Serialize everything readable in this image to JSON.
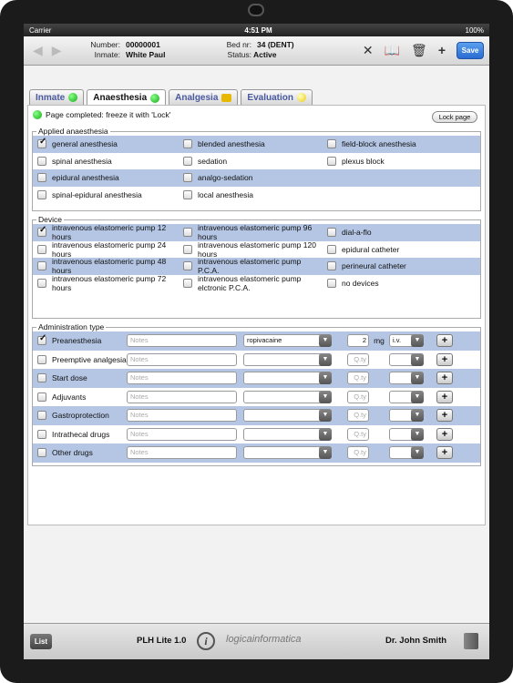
{
  "status": {
    "carrier": "Carrier",
    "time": "4:51 PM",
    "battery": "100%"
  },
  "header": {
    "number_label": "Number:",
    "number_value": "00000001",
    "inmate_label": "Inmate:",
    "inmate_value": "White Paul",
    "bed_label": "Bed nr:",
    "bed_value": "34 (DENT)",
    "status_label": "Status:",
    "status_value": "Active",
    "save_label": "Save"
  },
  "tabs": [
    {
      "label": "Inmate",
      "indicator": "green"
    },
    {
      "label": "Anaesthesia",
      "indicator": "green"
    },
    {
      "label": "Analgesia",
      "indicator": "lock"
    },
    {
      "label": "Evaluation",
      "indicator": "yellow"
    }
  ],
  "notice": "Page completed: freeze it with 'Lock'",
  "lock_button": "Lock page",
  "applied": {
    "legend": "Applied anaesthesia",
    "rows": [
      [
        {
          "label": "general anesthesia",
          "checked": true
        },
        {
          "label": "blended anesthesia",
          "checked": false
        },
        {
          "label": "field-block anesthesia",
          "checked": false
        }
      ],
      [
        {
          "label": "spinal anesthesia",
          "checked": false
        },
        {
          "label": "sedation",
          "checked": false
        },
        {
          "label": "plexus block",
          "checked": false
        }
      ],
      [
        {
          "label": "epidural anesthesia",
          "checked": false
        },
        {
          "label": "analgo-sedation",
          "checked": false
        },
        null
      ],
      [
        {
          "label": "spinal-epidural anesthesia",
          "checked": false
        },
        {
          "label": "local anesthesia",
          "checked": false
        },
        null
      ]
    ]
  },
  "device": {
    "legend": "Device",
    "rows": [
      [
        {
          "label": "intravenous elastomeric pump 12 hours",
          "checked": true
        },
        {
          "label": "intravenous elastomeric pump 96 hours",
          "checked": false
        },
        {
          "label": "dial-a-flo",
          "checked": false
        }
      ],
      [
        {
          "label": "intravenous elastomeric pump 24 hours",
          "checked": false
        },
        {
          "label": "intravenous elastomeric pump 120 hours",
          "checked": false
        },
        {
          "label": "epidural catheter",
          "checked": false
        }
      ],
      [
        {
          "label": "intravenous elastomeric pump 48 hours",
          "checked": false
        },
        {
          "label": "intravenous elastomeric pump P.C.A.",
          "checked": false
        },
        {
          "label": "perineural catheter",
          "checked": false
        }
      ],
      [
        {
          "label": "intravenous elastomeric pump 72 hours",
          "checked": false
        },
        {
          "label": "intravenous elastomeric pump elctronic P.C.A.",
          "checked": false
        },
        {
          "label": "no devices",
          "checked": false
        }
      ]
    ]
  },
  "admin": {
    "legend": "Administration type",
    "notes_placeholder": "Notes",
    "qty_placeholder": "Q.ty",
    "rows": [
      {
        "label": "Preanesthesia",
        "checked": true,
        "drug": "ropivacaine",
        "qty": "2",
        "unit": "mg",
        "route": "i.v."
      },
      {
        "label": "Preemptive analgesia",
        "checked": false,
        "drug": "",
        "qty": "",
        "unit": "",
        "route": ""
      },
      {
        "label": "Start dose",
        "checked": false,
        "drug": "",
        "qty": "",
        "unit": "",
        "route": ""
      },
      {
        "label": "Adjuvants",
        "checked": false,
        "drug": "",
        "qty": "",
        "unit": "",
        "route": ""
      },
      {
        "label": "Gastroprotection",
        "checked": false,
        "drug": "",
        "qty": "",
        "unit": "",
        "route": ""
      },
      {
        "label": "Intrathecal drugs",
        "checked": false,
        "drug": "",
        "qty": "",
        "unit": "",
        "route": ""
      },
      {
        "label": "Other drugs",
        "checked": false,
        "drug": "",
        "qty": "",
        "unit": "",
        "route": ""
      }
    ]
  },
  "footer": {
    "list_label": "List",
    "app_name": "PLH Lite 1.0",
    "logo_text": "logicainformatica",
    "user": "Dr. John Smith"
  }
}
